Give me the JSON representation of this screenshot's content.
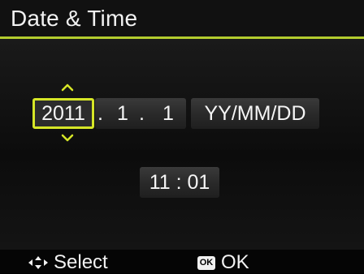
{
  "header": {
    "title": "Date & Time"
  },
  "date": {
    "year": "2011",
    "month": "1",
    "day": "1",
    "separator": ".",
    "format": "YY/MM/DD"
  },
  "time": {
    "value": "11 : 01"
  },
  "footer": {
    "select_label": "Select",
    "ok_badge": "OK",
    "ok_label": "OK"
  },
  "colors": {
    "accent": "#d6e627",
    "title_underline": "#b3cc2e",
    "field_bg": "#333333"
  },
  "icons": {
    "up": "up-arrow-icon",
    "down": "down-arrow-icon",
    "dpad": "four-way-arrow-icon",
    "ok": "ok-button-icon"
  }
}
